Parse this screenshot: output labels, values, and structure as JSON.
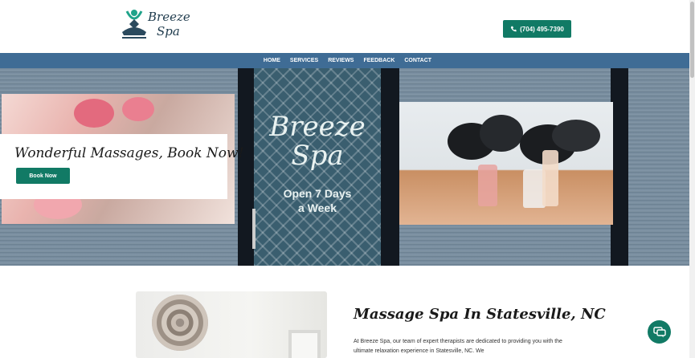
{
  "header": {
    "logo": {
      "line1": "Breeze",
      "line2": "Spa"
    },
    "phone_label": "(704) 495-7390"
  },
  "nav": {
    "items": [
      "HOME",
      "SERVICES",
      "REVIEWS",
      "FEEDBACK",
      "CONTACT"
    ]
  },
  "hero": {
    "door_brand_line1": "Breeze",
    "door_brand_line2": "Spa",
    "door_hours_line1": "Open 7 Days",
    "door_hours_line2": "a Week",
    "title": "Wonderful Massages, Book Now!",
    "book_label": "Book Now"
  },
  "section": {
    "title": "Massage Spa In Statesville, NC",
    "text": "At Breeze Spa, our team of expert therapists are dedicated to providing you with the ultimate relaxation experience in Statesville, NC. We"
  },
  "icons": {
    "phone": "phone-icon",
    "chat": "chat-icon",
    "logo": "meditation-figure-icon"
  },
  "colors": {
    "accent": "#117a65",
    "nav": "#3f6c95"
  }
}
